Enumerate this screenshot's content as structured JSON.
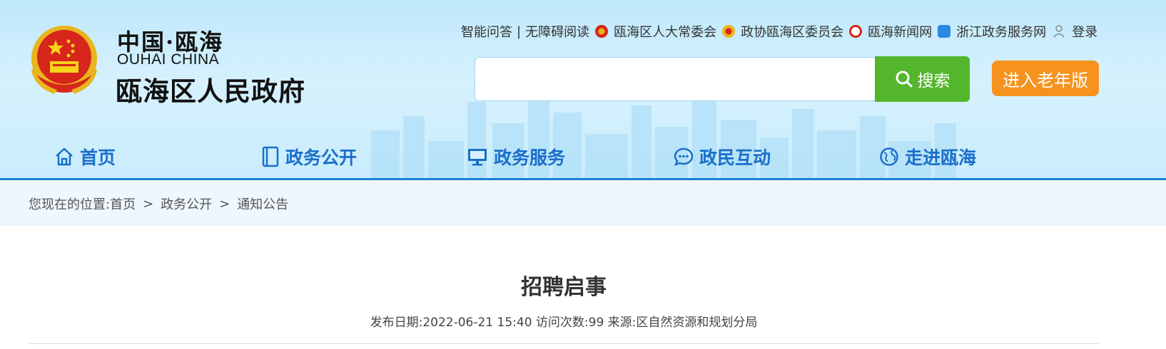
{
  "logo": {
    "small_cn": "中国·瓯海",
    "en": "OUHAI CHINA",
    "big_cn": "瓯海区人民政府"
  },
  "toplinks": {
    "qa": "智能问答",
    "sep": "|",
    "accessible": "无障碍阅读",
    "npc": "瓯海区人大常委会",
    "cppcc": "政协瓯海区委员会",
    "news": "瓯海新闻网",
    "zjservice": "浙江政务服务网",
    "login": "登录"
  },
  "search": {
    "placeholder": "",
    "button_label": "搜索"
  },
  "elder_mode_label": "进入老年版",
  "nav": {
    "home": "首页",
    "open": "政务公开",
    "service": "政务服务",
    "interact": "政民互动",
    "about": "走进瓯海"
  },
  "breadcrumb": {
    "prefix": "您现在的位置:",
    "items": [
      "首页",
      "政务公开",
      "通知公告"
    ],
    "separator": ">"
  },
  "article": {
    "title": "招聘启事",
    "meta": "发布日期:2022-06-21 15:40 访问次数:99 来源:区自然资源和规划分局"
  },
  "colors": {
    "nav_blue": "#1a6fc9",
    "search_green": "#54b62c",
    "elder_orange": "#f6921e",
    "header_line": "#1d7fd0"
  }
}
